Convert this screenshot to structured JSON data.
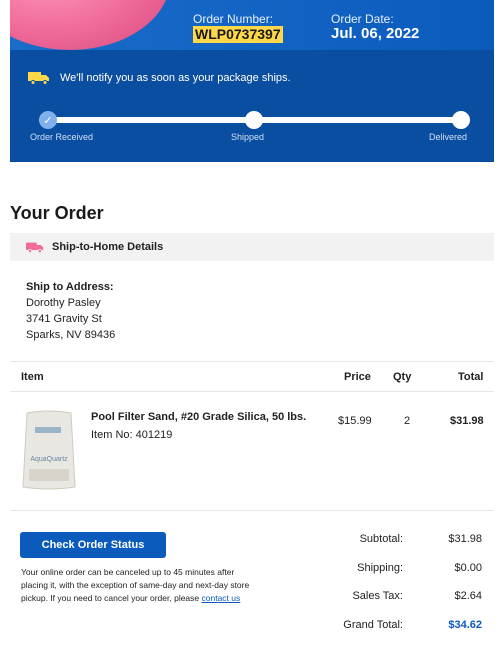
{
  "header": {
    "order_number_label": "Order Number:",
    "order_number": "WLP0737397",
    "order_date_label": "Order Date:",
    "order_date": "Jul. 06, 2022",
    "notify_text": "We'll notify you as soon as your package ships.",
    "icons": [
      "truck-icon",
      "checkmark-icon"
    ]
  },
  "tracking": {
    "steps": [
      "Order Received",
      "Shipped",
      "Delivered"
    ],
    "current_step": 0,
    "progress_fraction": 0.0
  },
  "order": {
    "title": "Your Order",
    "ship_section_title": "Ship-to-Home Details",
    "ship_to_label": "Ship to Address:",
    "address_lines": [
      "Dorothy Pasley",
      "3741 Gravity St",
      "Sparks, NV 89436"
    ]
  },
  "table": {
    "headers": [
      "Item",
      "Price",
      "Qty",
      "Total"
    ],
    "rows": [
      {
        "name": "Pool Filter Sand, #20 Grade Silica, 50 lbs.",
        "item_no": "Item No: 401219",
        "price": "$15.99",
        "qty": "2",
        "total": "$31.98",
        "image_brand": "AquaQuartz"
      }
    ]
  },
  "actions": {
    "check_status_label": "Check Order Status",
    "cancel_note": "Your online order can be canceled up to 45 minutes after placing it, with the exception of same-day and next-day store pickup. If you need to cancel your order, please",
    "contact_link": "contact us"
  },
  "summary": {
    "subtotal_label": "Subtotal:",
    "subtotal": "$31.98",
    "shipping_label": "Shipping:",
    "shipping": "$0.00",
    "tax_label": "Sales Tax:",
    "tax": "$2.64",
    "grand_total_label": "Grand Total:",
    "grand_total": "$34.62"
  },
  "colors": {
    "brand_blue": "#0b5bbd",
    "highlight": "#ffd84a",
    "pink_accent": "#f06a9a"
  }
}
